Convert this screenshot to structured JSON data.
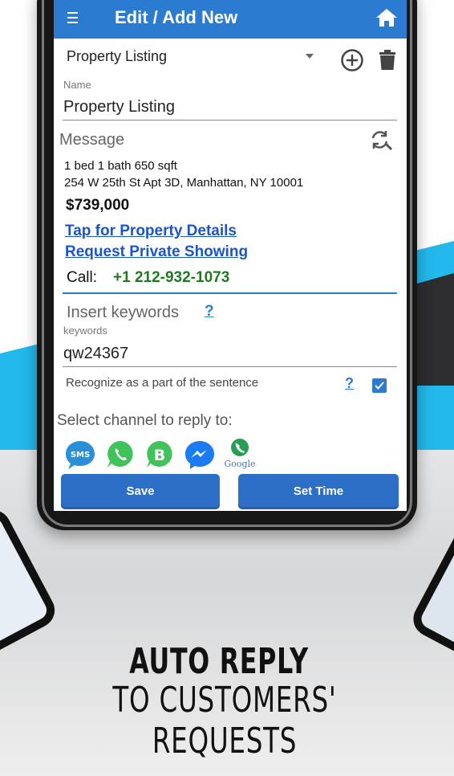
{
  "colors": {
    "accent": "#2b7bd0",
    "link": "#1a56c9",
    "phone": "#1f7a1f",
    "cyan_band": "#22b8ec"
  },
  "header": {
    "title": "Edit / Add New",
    "menu_icon": "hamburger-icon",
    "home_icon": "home-icon"
  },
  "template_selector": {
    "selected": "Property Listing",
    "add_icon": "add-circle-icon",
    "delete_icon": "trash-icon"
  },
  "name_field": {
    "label": "Name",
    "value": "Property Listing"
  },
  "message": {
    "label": "Message",
    "refresh_icon": "refresh-search-icon",
    "line1": "1 bed 1 bath 650 sqft",
    "line2": "254 W 25th St Apt 3D, Manhattan, NY 10001",
    "price": "$739,000",
    "link1": "Tap for Property Details",
    "link2": "Request Private Showing",
    "call_label": "Call:",
    "call_number": "+1 212-932-1073"
  },
  "keywords": {
    "heading": "Insert keywords",
    "help": "?",
    "label": "keywords",
    "value": "qw24367",
    "recognize_text": "Recognize as a part of the sentence",
    "recognize_help": "?",
    "recognize_checked": true
  },
  "channels": {
    "heading": "Select channel to reply to:",
    "items": [
      {
        "name": "sms-icon",
        "label": "SMS"
      },
      {
        "name": "whatsapp-icon",
        "label": ""
      },
      {
        "name": "whatsapp-business-icon",
        "label": "B"
      },
      {
        "name": "messenger-icon",
        "label": ""
      },
      {
        "name": "google-voice-icon",
        "label": "Google"
      }
    ]
  },
  "buttons": {
    "save": "Save",
    "set_time": "Set Time"
  },
  "promo": {
    "line1": "AUTO REPLY",
    "line2": "TO CUSTOMERS' REQUESTS"
  }
}
